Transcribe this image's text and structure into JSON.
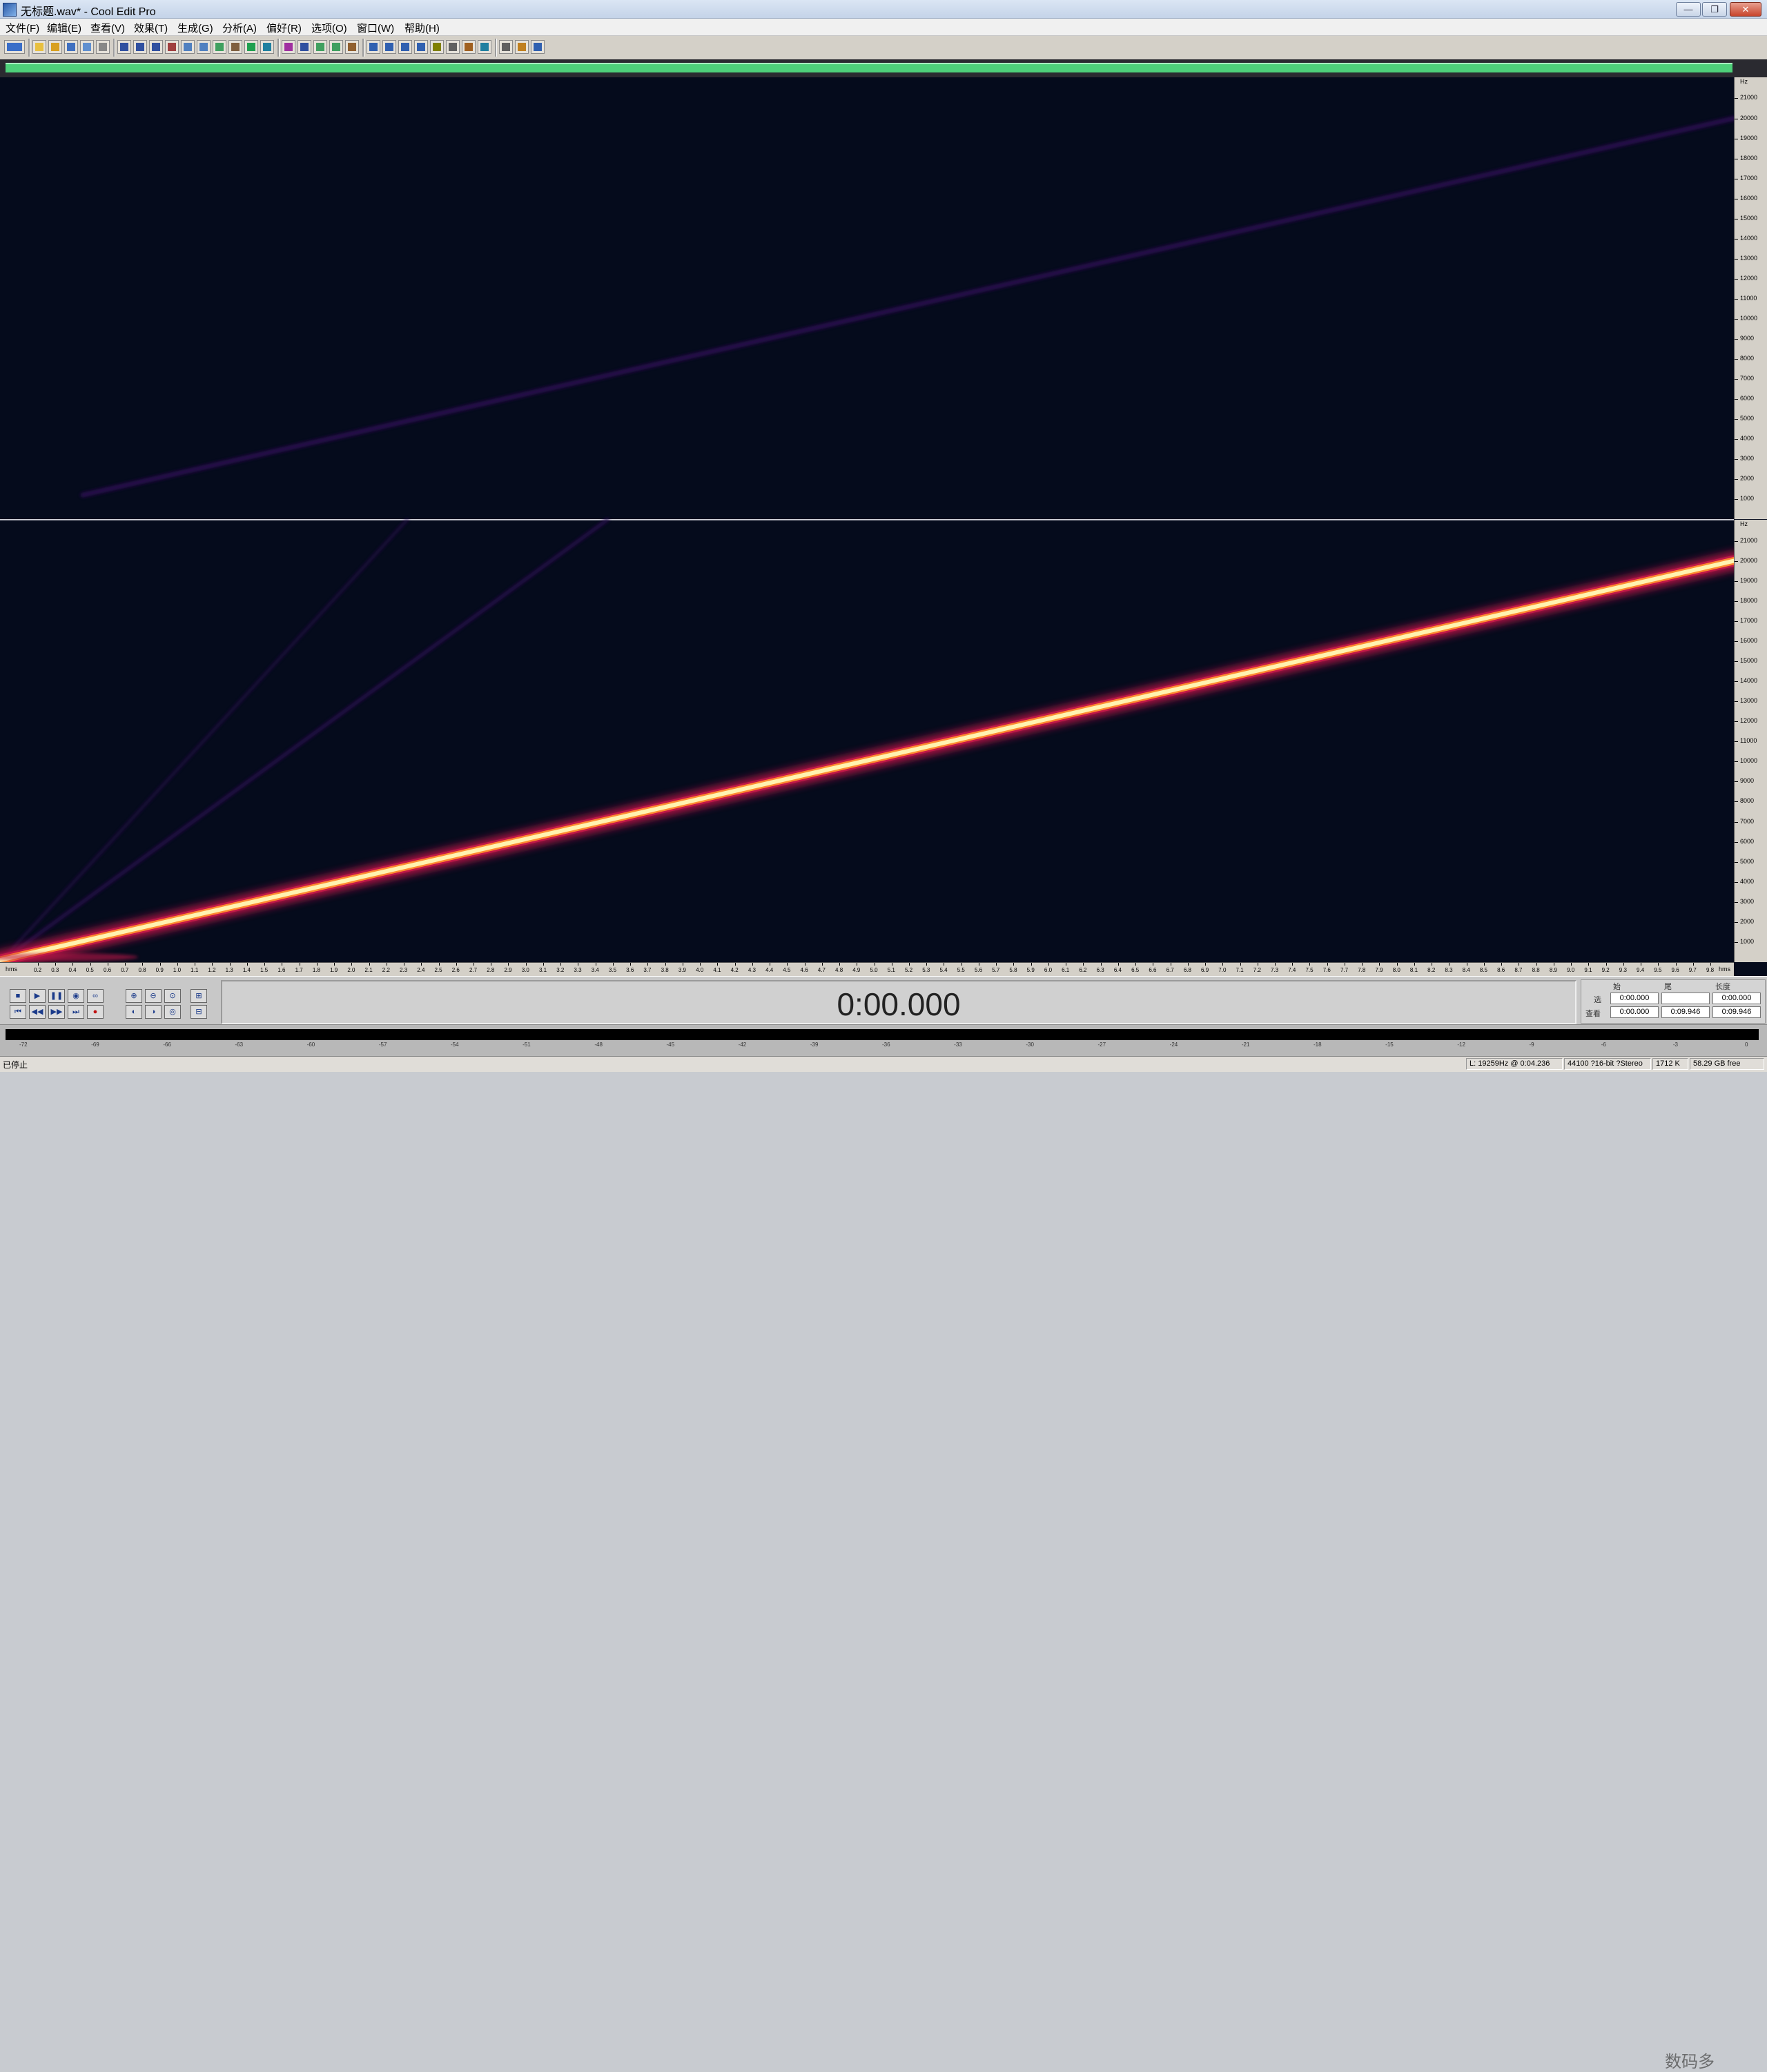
{
  "window": {
    "title": "无标题.wav* - Cool Edit Pro",
    "minimize": "—",
    "restore": "❐",
    "close": "✕"
  },
  "menu": [
    "文件(F)",
    "编辑(E)",
    "查看(V)",
    "效果(T)",
    "生成(G)",
    "分析(A)",
    "偏好(R)",
    "选项(O)",
    "窗口(W)",
    "帮助(H)"
  ],
  "toolbar": {
    "icons": [
      "waveform-view-icon",
      "new-file-icon",
      "open-file-icon",
      "save-icon",
      "save-as-icon",
      "close-file-icon",
      "undo-icon",
      "redo-icon",
      "repeat-icon",
      "cut-icon",
      "copy-icon",
      "paste-icon",
      "mix-paste-icon",
      "trim-icon",
      "generate-icon",
      "loop-icon",
      "spectral-view-icon",
      "marker-icon",
      "mix-icon",
      "snap-icon",
      "metronome-icon",
      "cd-icon",
      "batch-icon",
      "cue-list-icon",
      "play-list-icon",
      "tone-icon",
      "noise-icon",
      "fft-icon",
      "level-icon",
      "settings-icon",
      "help-icon",
      "info-icon"
    ]
  },
  "spectral": {
    "hz_label": "Hz",
    "upper_ticks": [
      "21000",
      "20000",
      "19000",
      "18000",
      "17000",
      "16000",
      "15000",
      "14000",
      "13000",
      "12000",
      "11000",
      "10000",
      "9000",
      "8000",
      "7000",
      "6000",
      "5000",
      "4000",
      "3000",
      "2000",
      "1000"
    ],
    "lower_ticks": [
      "21000",
      "20000",
      "19000",
      "18000",
      "17000",
      "16000",
      "15000",
      "14000",
      "13000",
      "12000",
      "11000",
      "10000",
      "9000",
      "8000",
      "7000",
      "6000",
      "5000",
      "4000",
      "3000",
      "2000",
      "1000"
    ],
    "max_freq_hz": 22050,
    "sweep_start_hz": 0,
    "sweep_end_hz": 20000,
    "colors": {
      "background": "#050b1c",
      "sweep_core": "#fff3b0",
      "sweep_mid": "#ff8a30",
      "sweep_edge": "#c01848",
      "harmonic": "#2a1050"
    }
  },
  "time_ruler": {
    "unit_left": "hms",
    "unit_right": "hms",
    "labels": [
      "0.2",
      "0.3",
      "0.4",
      "0.5",
      "0.6",
      "0.7",
      "0.8",
      "0.9",
      "1.0",
      "1.1",
      "1.2",
      "1.3",
      "1.4",
      "1.5",
      "1.6",
      "1.7",
      "1.8",
      "1.9",
      "2.0",
      "2.1",
      "2.2",
      "2.3",
      "2.4",
      "2.5",
      "2.6",
      "2.7",
      "2.8",
      "2.9",
      "3.0",
      "3.1",
      "3.2",
      "3.3",
      "3.4",
      "3.5",
      "3.6",
      "3.7",
      "3.8",
      "3.9",
      "4.0",
      "4.1",
      "4.2",
      "4.3",
      "4.4",
      "4.5",
      "4.6",
      "4.7",
      "4.8",
      "4.9",
      "5.0",
      "5.1",
      "5.2",
      "5.3",
      "5.4",
      "5.5",
      "5.6",
      "5.7",
      "5.8",
      "5.9",
      "6.0",
      "6.1",
      "6.2",
      "6.3",
      "6.4",
      "6.5",
      "6.6",
      "6.7",
      "6.8",
      "6.9",
      "7.0",
      "7.1",
      "7.2",
      "7.3",
      "7.4",
      "7.5",
      "7.6",
      "7.7",
      "7.8",
      "7.9",
      "8.0",
      "8.1",
      "8.2",
      "8.3",
      "8.4",
      "8.5",
      "8.6",
      "8.7",
      "8.8",
      "8.9",
      "9.0",
      "9.1",
      "9.2",
      "9.3",
      "9.4",
      "9.5",
      "9.6",
      "9.7",
      "9.8"
    ]
  },
  "transport": {
    "time": "0:00.000",
    "selection": {
      "col_start": "始",
      "col_end": "尾",
      "col_length": "长度",
      "row_sel": "选",
      "row_view": "查看",
      "sel_start": "0:00.000",
      "sel_end": "",
      "sel_length": "0:00.000",
      "view_start": "0:00.000",
      "view_end": "0:09.946",
      "view_length": "0:09.946"
    }
  },
  "meter": {
    "scale": [
      "-72",
      "-69",
      "-66",
      "-63",
      "-60",
      "-57",
      "-54",
      "-51",
      "-48",
      "-45",
      "-42",
      "-39",
      "-36",
      "-33",
      "-30",
      "-27",
      "-24",
      "-21",
      "-18",
      "-15",
      "-12",
      "-9",
      "-6",
      "-3",
      "0"
    ]
  },
  "status": {
    "state": "已停止",
    "cursor": "L: 19259Hz @  0:04.236",
    "format": "44100 ?16-bit ?Stereo",
    "size": "1712 K",
    "free": "58.29 GB free"
  },
  "watermark": "数码多"
}
